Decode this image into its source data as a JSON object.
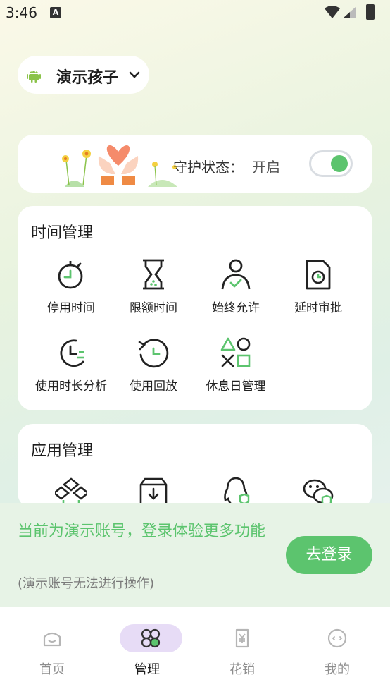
{
  "status_bar": {
    "time": "3:46",
    "notification_glyph": "A"
  },
  "child_selector": {
    "name": "演示孩子"
  },
  "guard": {
    "label": "守护状态：",
    "value": "开启",
    "toggle_on": true
  },
  "time_management": {
    "title": "时间管理",
    "items": [
      {
        "label": "停用时间",
        "icon": "stopwatch-icon"
      },
      {
        "label": "限额时间",
        "icon": "hourglass-icon"
      },
      {
        "label": "始终允许",
        "icon": "person-check-icon"
      },
      {
        "label": "延时审批",
        "icon": "document-clock-icon"
      },
      {
        "label": "使用时长分析",
        "icon": "usage-analysis-icon"
      },
      {
        "label": "使用回放",
        "icon": "playback-icon"
      },
      {
        "label": "休息日管理",
        "icon": "shapes-icon"
      }
    ]
  },
  "app_management": {
    "title": "应用管理",
    "items": [
      {
        "icon": "apps-box-icon"
      },
      {
        "icon": "download-box-icon"
      },
      {
        "icon": "qq-shield-icon"
      },
      {
        "icon": "wechat-shield-icon"
      }
    ]
  },
  "demo_banner": {
    "message": "当前为演示账号，登录体验更多功能",
    "sub": "(演示账号无法进行操作)",
    "login_button": "去登录"
  },
  "tab_bar": {
    "tabs": [
      {
        "label": "首页",
        "icon": "home-icon",
        "active": false
      },
      {
        "label": "管理",
        "icon": "manage-icon",
        "active": true
      },
      {
        "label": "花销",
        "icon": "expense-icon",
        "active": false
      },
      {
        "label": "我的",
        "icon": "profile-icon",
        "active": false
      }
    ]
  },
  "colors": {
    "accent": "#5cc46e",
    "active_tab_bg": "#e7dcf6",
    "banner_bg": "#e7f3e6"
  }
}
